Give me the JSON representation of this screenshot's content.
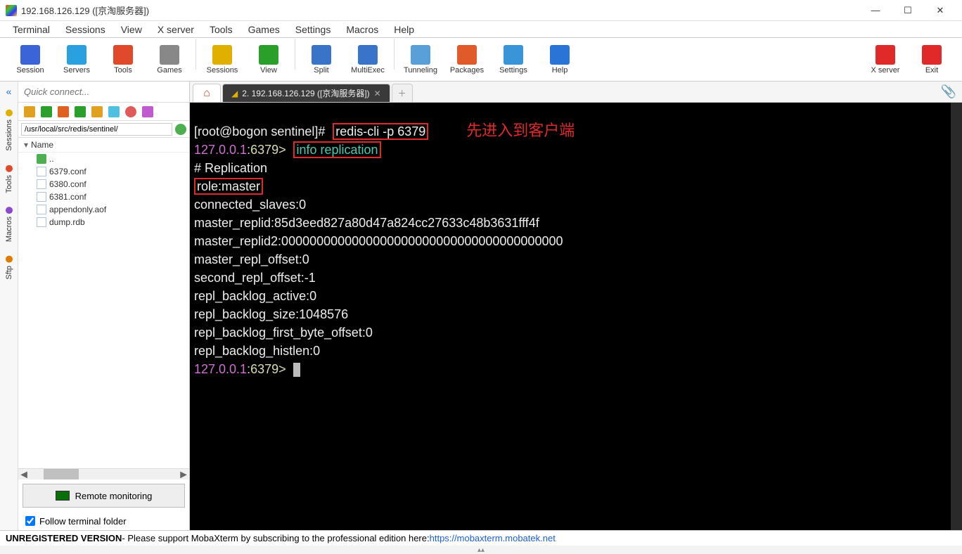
{
  "window": {
    "title": "192.168.126.129 ([京淘服务器])"
  },
  "menubar": [
    "Terminal",
    "Sessions",
    "View",
    "X server",
    "Tools",
    "Games",
    "Settings",
    "Macros",
    "Help"
  ],
  "toolbar": [
    {
      "label": "Session",
      "color": "#3a64d8"
    },
    {
      "label": "Servers",
      "color": "#2aa0e0"
    },
    {
      "label": "Tools",
      "color": "#e04a2a"
    },
    {
      "label": "Games",
      "color": "#888"
    },
    {
      "label": "Sessions",
      "color": "#e0b000"
    },
    {
      "label": "View",
      "color": "#2aa02a"
    },
    {
      "label": "Split",
      "color": "#3a74c8"
    },
    {
      "label": "MultiExec",
      "color": "#3a74c8"
    },
    {
      "label": "Tunneling",
      "color": "#5aa0d8"
    },
    {
      "label": "Packages",
      "color": "#e05a2a"
    },
    {
      "label": "Settings",
      "color": "#3a94d8"
    },
    {
      "label": "Help",
      "color": "#2a74d8"
    }
  ],
  "toolbar_right": [
    {
      "label": "X server",
      "color": "#e02a2a"
    },
    {
      "label": "Exit",
      "color": "#e02a2a"
    }
  ],
  "quick_connect_placeholder": "Quick connect...",
  "left_tabs": [
    {
      "label": "Sessions",
      "color": "#e0b000"
    },
    {
      "label": "Tools",
      "color": "#e04a2a"
    },
    {
      "label": "Macros",
      "color": "#8a4ad0"
    },
    {
      "label": "Sftp",
      "color": "#e07a00"
    }
  ],
  "sidebar": {
    "path": "/usr/local/src/redis/sentinel/",
    "header": "Name",
    "parent": "..",
    "files": [
      "6379.conf",
      "6380.conf",
      "6381.conf",
      "appendonly.aof",
      "dump.rdb"
    ],
    "remote_monitoring": "Remote monitoring",
    "follow_terminal": "Follow terminal folder"
  },
  "tabs": {
    "active_label": "2.  192.168.126.129 ([京淘服务器])"
  },
  "terminal": {
    "prompt_user": "[root@bogon sentinel]#",
    "cmd1": "redis-cli -p 6379",
    "annot1": "先进入到客户端",
    "host": "127.0.0.1",
    "port": ":6379>",
    "cmd2": "info replication",
    "header": "# Replication",
    "role_line": "role:master",
    "lines": [
      "connected_slaves:0",
      "master_replid:85d3eed827a80d47a824cc27633c48b3631fff4f",
      "master_replid2:0000000000000000000000000000000000000000",
      "master_repl_offset:0",
      "second_repl_offset:-1",
      "repl_backlog_active:0",
      "repl_backlog_size:1048576",
      "repl_backlog_first_byte_offset:0",
      "repl_backlog_histlen:0"
    ]
  },
  "statusbar": {
    "unreg": "UNREGISTERED VERSION",
    "msg": "  -  Please support MobaXterm by subscribing to the professional edition here:  ",
    "link": "https://mobaxterm.mobatek.net"
  }
}
